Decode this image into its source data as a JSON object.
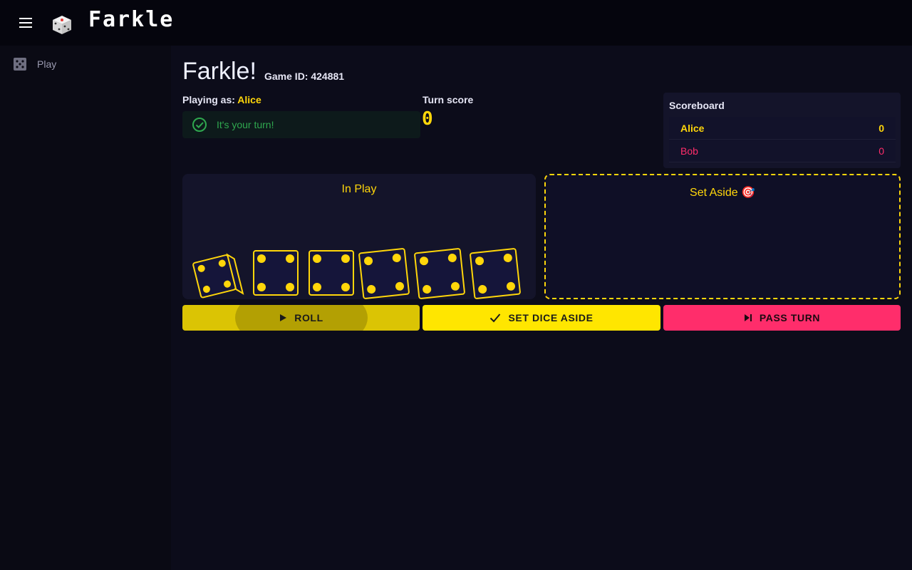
{
  "app": {
    "title": "Farkle"
  },
  "sidebar": {
    "items": [
      {
        "label": "Play",
        "icon": "dice-icon"
      }
    ]
  },
  "game": {
    "heading": "Farkle!",
    "game_id_label": "Game ID: 424881",
    "playing_as_label": "Playing as:",
    "player_name": "Alice",
    "status_text": "It's your turn!",
    "turn_score_label": "Turn score",
    "turn_score_value": "0"
  },
  "scoreboard": {
    "title": "Scoreboard",
    "rows": [
      {
        "player": "Alice",
        "score": "0"
      },
      {
        "player": "Bob",
        "score": "0"
      }
    ]
  },
  "in_play": {
    "title": "In Play",
    "dice": [
      4,
      4,
      4,
      4,
      4,
      4
    ]
  },
  "set_aside": {
    "title": "Set Aside 🎯"
  },
  "actions": {
    "roll": "ROLL",
    "set_dice_aside": "SET DICE ASIDE",
    "pass_turn": "PASS TURN"
  },
  "colors": {
    "accent": "#ffd60a",
    "danger": "#ff2d6b",
    "success": "#2fa84f",
    "background": "#0c0c1a"
  }
}
